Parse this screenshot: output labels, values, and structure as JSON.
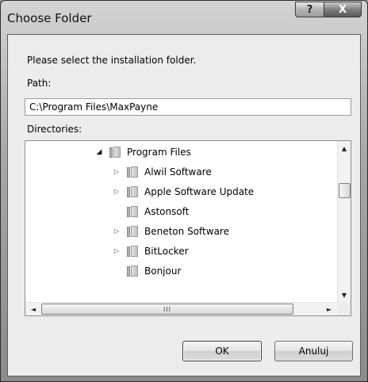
{
  "window": {
    "title": "Choose Folder",
    "help_label": "?",
    "close_label": "X"
  },
  "dialog": {
    "prompt": "Please select the installation folder.",
    "path_label": "Path:",
    "path_value": "C:\\Program Files\\MaxPayne",
    "directories_label": "Directories:",
    "ok_label": "OK",
    "cancel_label": "Anuluj"
  },
  "tree": {
    "items": [
      {
        "label": "Program Files",
        "expander": "expanded",
        "level": 0
      },
      {
        "label": "Alwil Software",
        "expander": "collapsed",
        "level": 1
      },
      {
        "label": "Apple Software Update",
        "expander": "collapsed",
        "level": 1
      },
      {
        "label": "Astonsoft",
        "expander": "none",
        "level": 1
      },
      {
        "label": "Beneton Software",
        "expander": "collapsed",
        "level": 1
      },
      {
        "label": "BitLocker",
        "expander": "collapsed",
        "level": 1
      },
      {
        "label": "Bonjour",
        "expander": "none",
        "level": 1
      }
    ]
  },
  "scrollbars": {
    "vertical_up": "▲",
    "vertical_down": "▼",
    "horizontal_left": "◄",
    "horizontal_right": "►",
    "horizontal_grip": "III"
  },
  "icons": {
    "expanded": "expanded-triangle-icon",
    "collapsed": "collapsed-triangle-icon",
    "folder": "folder-icon"
  }
}
